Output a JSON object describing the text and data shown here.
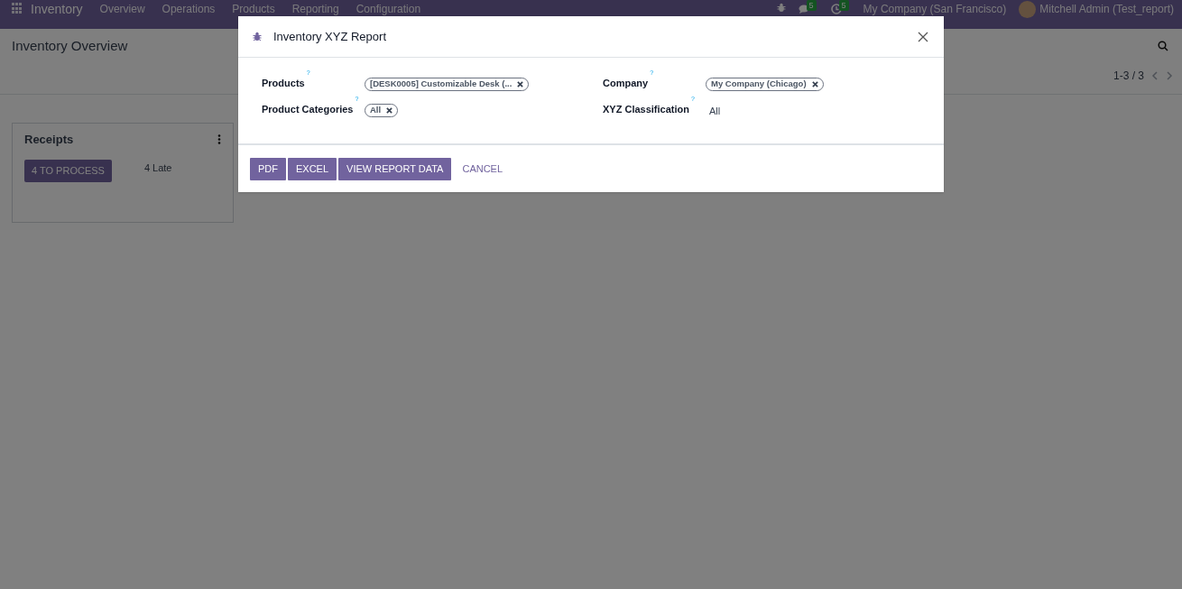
{
  "navbar": {
    "app_name": "Inventory",
    "menu": [
      "Overview",
      "Operations",
      "Products",
      "Reporting",
      "Configuration"
    ],
    "messages_count": "5",
    "activities_count": "5",
    "company": "My Company (San Francisco)",
    "user": "Mitchell Admin (Test_report)"
  },
  "page": {
    "title": "Inventory Overview",
    "pager": "1-3 / 3"
  },
  "card": {
    "title": "Receipts",
    "button": "4 TO PROCESS",
    "late": "4 Late"
  },
  "dialog": {
    "title": "Inventory XYZ Report",
    "fields": [
      {
        "label": "Products",
        "help": "?",
        "kind": "tags",
        "tags": [
          "[DESK0005] Customizable Desk (..."
        ]
      },
      {
        "label": "Company",
        "help": "?",
        "kind": "tags",
        "tags": [
          "My Company (Chicago)"
        ]
      },
      {
        "label": "Product Categories",
        "help": "?",
        "kind": "tags",
        "tags": [
          "All"
        ]
      },
      {
        "label": "XYZ Classification",
        "help": "?",
        "kind": "text",
        "value": "All"
      }
    ],
    "buttons": [
      {
        "label": "PDF",
        "kind": "primary"
      },
      {
        "label": "EXCEL",
        "kind": "primary"
      },
      {
        "label": "VIEW REPORT DATA",
        "kind": "primary"
      },
      {
        "label": "CANCEL",
        "kind": "link"
      }
    ]
  }
}
